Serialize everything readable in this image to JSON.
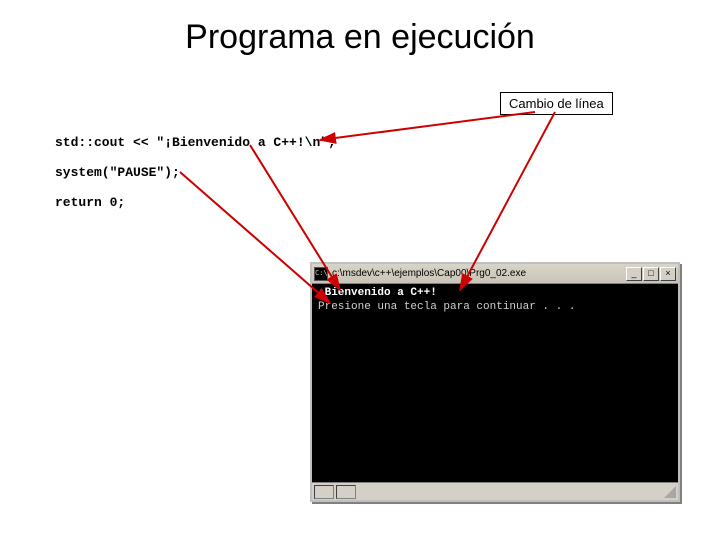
{
  "title": "Programa en ejecución",
  "callout_label": "Cambio de línea",
  "code": {
    "line1": "std::cout << \"¡Bienvenido a C++!\\n\";",
    "line2": "system(\"PAUSE\");",
    "line3": "return 0;"
  },
  "console": {
    "title_text": "c:\\msdev\\c++\\ejemplos\\Cap00\\Prg0_02.exe",
    "output_line1": "¡Bienvenido a C++!",
    "output_line2": "Presione una tecla para continuar . . .",
    "btn_min": "_",
    "btn_max": "□",
    "btn_close": "×"
  }
}
